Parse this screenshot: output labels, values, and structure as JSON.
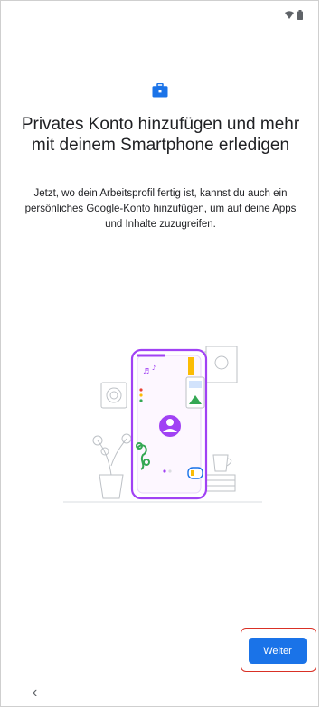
{
  "status_bar": {
    "icons": [
      "wifi-icon",
      "battery-icon"
    ]
  },
  "main": {
    "title": "Privates Konto hinzufügen und mehr mit deinem Smartphone erledigen",
    "description": "Jetzt, wo dein Arbeitsprofil fertig ist, kannst du auch ein persönliches Google-Konto hinzufügen, um auf deine Apps und Inhalte zuzugreifen.",
    "icon": "briefcase-icon"
  },
  "actions": {
    "primary_label": "Weiter"
  },
  "nav": {
    "back_symbol": "‹"
  },
  "colors": {
    "accent": "#1a73e8",
    "illustration_purple": "#a142f4",
    "highlight": "#d93025"
  }
}
